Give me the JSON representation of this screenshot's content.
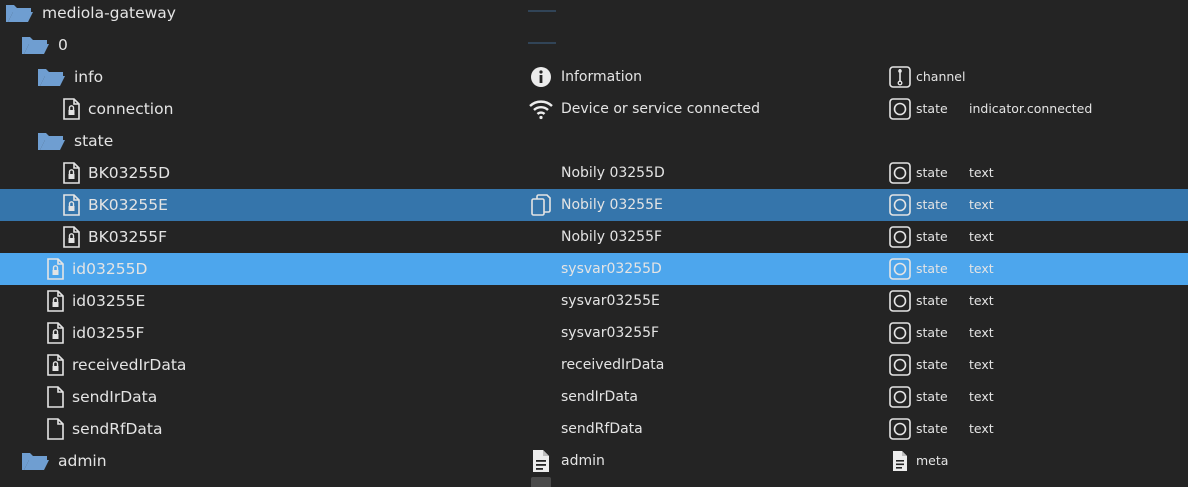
{
  "colors": {
    "background": "#242424",
    "text": "#e4e4e4",
    "folder": "#6f9ed1",
    "selected_row": "#3575ab",
    "hover_row": "#4da6ed"
  },
  "rows": [
    {
      "name": "mediola-gateway",
      "icon": "folder-open-icon"
    },
    {
      "name": "0",
      "icon": "folder-open-icon"
    },
    {
      "name": "info",
      "icon": "folder-open-icon",
      "role_icon": "info-circle-icon",
      "common_name": "Information",
      "type_icon": "channel-icon",
      "type": "channel"
    },
    {
      "name": "connection",
      "icon": "state-file-locked-icon",
      "role_icon": "wifi-icon",
      "common_name": "Device or service connected",
      "type_icon": "state-icon",
      "type": "state",
      "role": "indicator.connected"
    },
    {
      "name": "state",
      "icon": "folder-open-icon"
    },
    {
      "name": "BK03255D",
      "icon": "state-file-locked-icon",
      "common_name": "Nobily 03255D",
      "type_icon": "state-icon",
      "type": "state",
      "role": "text"
    },
    {
      "name": "BK03255E",
      "icon": "state-file-locked-icon",
      "role_icon": "copy-icon",
      "common_name": "Nobily 03255E",
      "type_icon": "state-icon",
      "type": "state",
      "role": "text"
    },
    {
      "name": "BK03255F",
      "icon": "state-file-locked-icon",
      "common_name": "Nobily 03255F",
      "type_icon": "state-icon",
      "type": "state",
      "role": "text"
    },
    {
      "name": "id03255D",
      "icon": "state-file-locked-icon",
      "common_name": "sysvar03255D",
      "type_icon": "state-icon",
      "type": "state",
      "role": "text"
    },
    {
      "name": "id03255E",
      "icon": "state-file-locked-icon",
      "common_name": "sysvar03255E",
      "type_icon": "state-icon",
      "type": "state",
      "role": "text"
    },
    {
      "name": "id03255F",
      "icon": "state-file-locked-icon",
      "common_name": "sysvar03255F",
      "type_icon": "state-icon",
      "type": "state",
      "role": "text"
    },
    {
      "name": "receivedIrData",
      "icon": "state-file-locked-icon",
      "common_name": "receivedIrData",
      "type_icon": "state-icon",
      "type": "state",
      "role": "text"
    },
    {
      "name": "sendIrData",
      "icon": "state-file-icon",
      "common_name": "sendIrData",
      "type_icon": "state-icon",
      "type": "state",
      "role": "text"
    },
    {
      "name": "sendRfData",
      "icon": "state-file-icon",
      "common_name": "sendRfData",
      "type_icon": "state-icon",
      "type": "state",
      "role": "text"
    },
    {
      "name": "admin",
      "icon": "folder-open-icon",
      "role_icon": "document-icon",
      "common_name": "admin",
      "type_icon": "meta-icon",
      "type": "meta"
    }
  ]
}
